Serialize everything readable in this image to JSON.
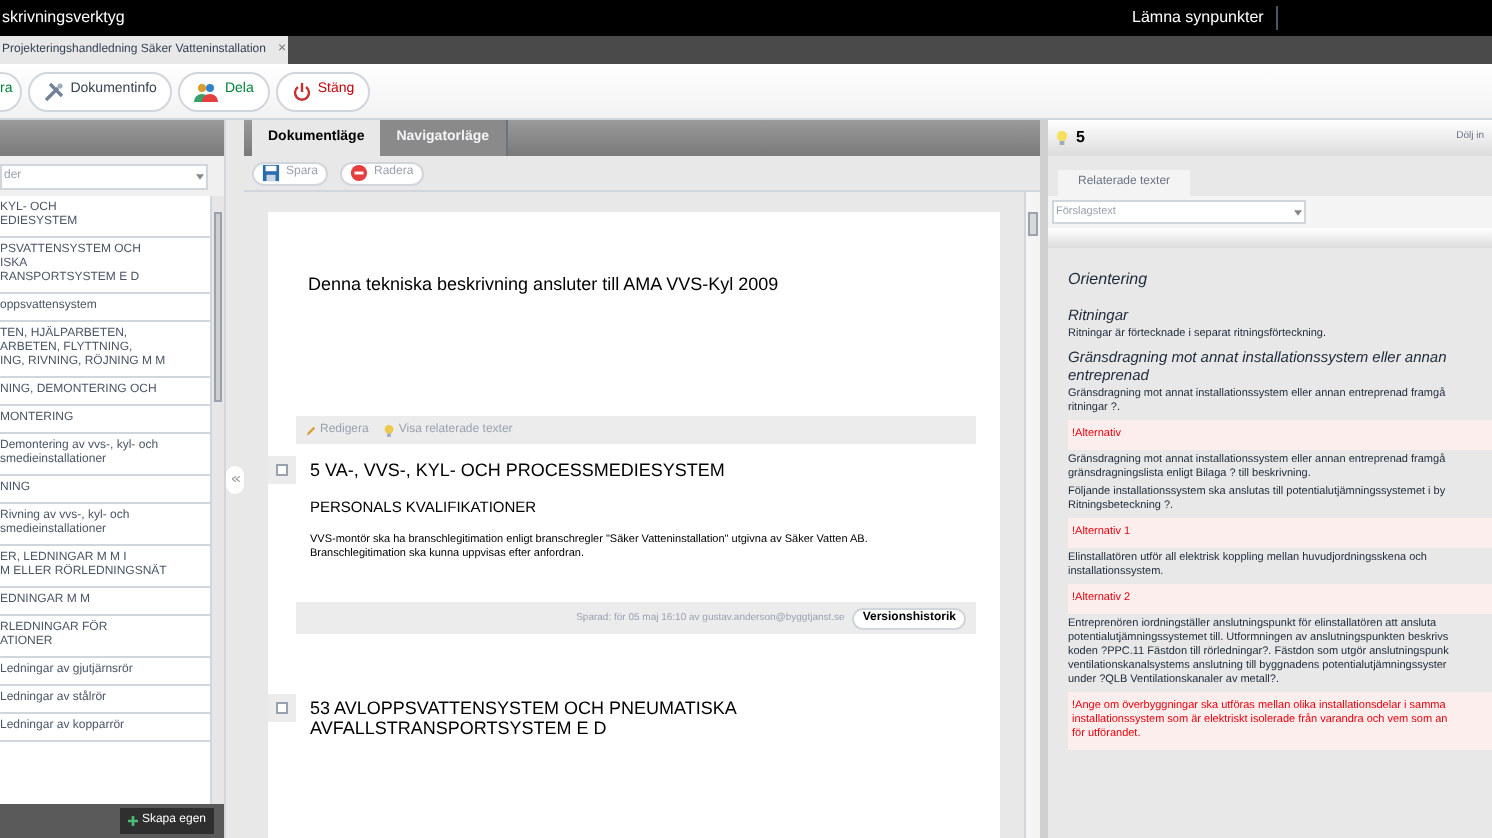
{
  "app_bar": {
    "title": "skrivningsverktyg",
    "feedback_link": "Lämna synpunkter"
  },
  "document_tabs": [
    {
      "label": "Projekteringshandledning Säker Vatteninstallation",
      "close": "×",
      "selected": true
    }
  ],
  "toolbar": [
    {
      "kind": "save",
      "label": "ra"
    },
    {
      "kind": "info",
      "label": "Dokumentinfo"
    },
    {
      "kind": "share",
      "label": "Dela"
    },
    {
      "kind": "close",
      "label": "Stäng"
    }
  ],
  "left_panel": {
    "filter": {
      "value": "der"
    },
    "items": [
      {
        "lines": [
          "KYL- OCH",
          "EDIESYSTEM"
        ]
      },
      {
        "lines": [
          "PSVATTENSYSTEM OCH",
          "ISKA",
          "RANSPORTSYSTEM E D"
        ]
      },
      {
        "lines": [
          "oppsvattensystem"
        ]
      },
      {
        "lines": [
          "TEN, HJÄLPARBETEN,",
          "ARBETEN, FLYTTNING,",
          "ING, RIVNING, RÖJNING M M"
        ]
      },
      {
        "lines": [
          "NING, DEMONTERING OCH"
        ]
      },
      {
        "lines": [
          "MONTERING"
        ]
      },
      {
        "lines": [
          "Demontering av vvs-, kyl- och",
          "smedieinstallationer"
        ]
      },
      {
        "lines": [
          "NING"
        ]
      },
      {
        "lines": [
          "Rivning av vvs-, kyl- och",
          "smedieinstallationer"
        ]
      },
      {
        "lines": [
          "ER, LEDNINGAR M M I",
          "M ELLER RÖRLEDNINGSNÄT"
        ]
      },
      {
        "lines": [
          "EDNINGAR M M"
        ]
      },
      {
        "lines": [
          "RLEDNINGAR FÖR",
          "ATIONER"
        ]
      },
      {
        "lines": [
          "Ledningar av gjutjärnsrör"
        ]
      },
      {
        "lines": [
          "Ledningar av stålrör"
        ]
      },
      {
        "lines": [
          "Ledningar av kopparrör"
        ]
      }
    ],
    "create_button": "Skapa egen"
  },
  "center": {
    "tabs": [
      {
        "label": "Dokumentläge",
        "selected": true
      },
      {
        "label": "Navigatorläge",
        "selected": false
      }
    ],
    "actions": [
      {
        "kind": "save",
        "label": "Spara",
        "disabled": true
      },
      {
        "kind": "delete",
        "label": "Radera",
        "disabled": true
      }
    ],
    "intro": "Denna tekniska beskrivning ansluter till AMA VVS-Kyl 2009",
    "sections": [
      {
        "actions": [
          "Redigera",
          "Visa relaterade texter"
        ],
        "checked": false,
        "number": "5",
        "title": [
          "VA-, VVS-, KYL- OCH PROCESSMEDIESYSTEM"
        ],
        "subtitle": "PERSONALS KVALIFIKATIONER",
        "body": [
          "VVS-montör ska ha branschlegitimation enligt branschregler \"Säker Vatteninstallation\" utgivna av Säker Vatten AB.",
          "Branschlegitimation ska kunna uppvisas efter anfordran."
        ],
        "saved": "Sparad: för 05 maj 16:10 av gustav.anderson@byggtjanst.se",
        "history_button": "Versionshistorik"
      },
      {
        "checked": false,
        "number": "53",
        "title": [
          "AVLOPPSVATTENSYSTEM OCH PNEUMATISKA",
          "AVFALLSTRANSPORTSYSTEM E D"
        ]
      }
    ]
  },
  "right_panel": {
    "count": "5",
    "hide_link": "Dölj in",
    "tab": "Relaterade texter",
    "filter": {
      "value": "Förslagstext"
    },
    "blocks": [
      {
        "kind": "heading",
        "lines": [
          "Orientering"
        ]
      },
      {
        "kind": "subheading",
        "lines": [
          "Ritningar"
        ]
      },
      {
        "kind": "text",
        "lines": [
          "Ritningar är förtecknade i separat ritningsförteckning."
        ]
      },
      {
        "kind": "subheading",
        "lines": [
          "Gränsdragning mot annat installationssystem eller annan",
          "entreprenad"
        ]
      },
      {
        "kind": "text",
        "lines": [
          "Gränsdragning mot annat installationssystem eller annan entreprenad framgå",
          "ritningar ?."
        ]
      },
      {
        "kind": "alternative",
        "lines": [
          "!Alternativ"
        ]
      },
      {
        "kind": "text",
        "lines": [
          "Gränsdragning mot annat installationssystem eller annan entreprenad framgå",
          "gränsdragningslista enligt Bilaga ? till beskrivning."
        ]
      },
      {
        "kind": "text",
        "lines": [
          "Följande installationssystem ska anslutas till potentialutjämningssystemet i by",
          "Ritningsbeteckning ?."
        ]
      },
      {
        "kind": "alternative",
        "lines": [
          "!Alternativ 1"
        ]
      },
      {
        "kind": "text",
        "lines": [
          "Elinstallatören utför all elektrisk koppling mellan huvudjordningsskena och",
          "installationssystem."
        ]
      },
      {
        "kind": "alternative",
        "lines": [
          "!Alternativ 2"
        ]
      },
      {
        "kind": "text",
        "lines": [
          "Entreprenören iordningställer anslutningspunkt för elinstallatören att ansluta",
          "potentialutjämningssystemet till. Utformningen av anslutningspunkten beskrivs",
          "koden ?PPC.11 Fästdon till rörledningar?. Fästdon som utgör anslutningspunk",
          "ventilationskanalsystems anslutning till byggnadens potentialutjämningssyster",
          "under ?QLB Ventilationskanaler av metall?."
        ]
      },
      {
        "kind": "alternative",
        "lines": [
          "!Ange om överbyggningar ska utföras mellan olika installationsdelar i samma",
          "installationssystem som är elektriskt isolerade från varandra och vem som an",
          "för utförandet."
        ]
      }
    ]
  }
}
